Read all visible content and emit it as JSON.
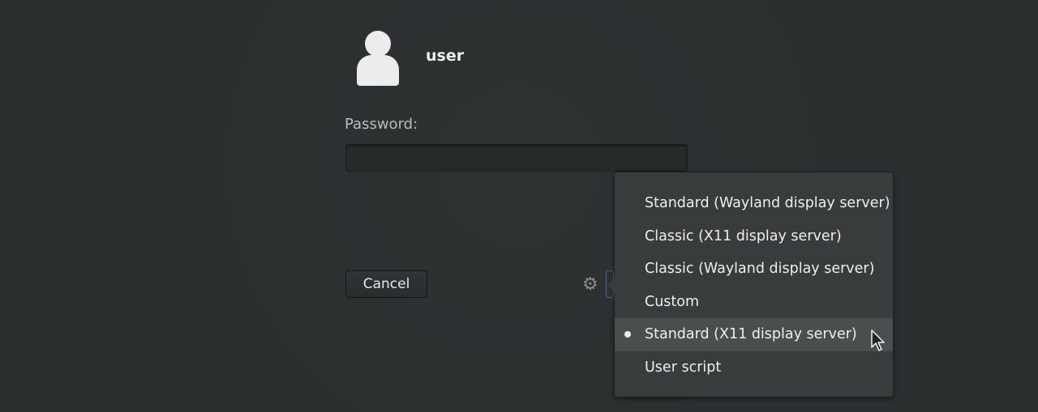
{
  "user": {
    "name": "user",
    "avatar_icon": "user-avatar-icon"
  },
  "password": {
    "label": "Password:",
    "value": "",
    "placeholder": ""
  },
  "buttons": {
    "cancel_label": "Cancel",
    "session_icon": "gear-icon"
  },
  "session_menu": {
    "items": [
      {
        "label": "Standard (Wayland display server)",
        "selected": false
      },
      {
        "label": "Classic (X11 display server)",
        "selected": false
      },
      {
        "label": "Classic (Wayland display server)",
        "selected": false
      },
      {
        "label": "Custom",
        "selected": false
      },
      {
        "label": "Standard (X11 display server)",
        "selected": true
      },
      {
        "label": "User script",
        "selected": false
      }
    ],
    "hovered_index": 4
  },
  "colors": {
    "background": "#2b2f30",
    "menu_background": "#383c3d",
    "menu_hover": "#4a4e4f",
    "focus_accent": "#2a6db1"
  }
}
